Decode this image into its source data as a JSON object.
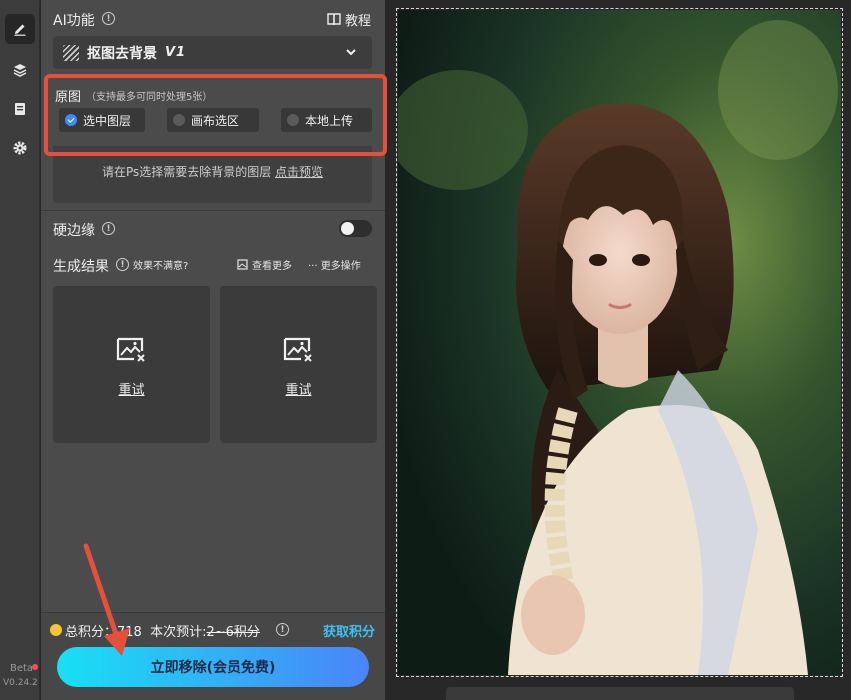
{
  "sidebar": {
    "beta_label": "Beta",
    "version": "V0.24.2"
  },
  "header": {
    "title": "AI功能",
    "tutorial_label": "教程"
  },
  "feature_select": {
    "label": "抠图去背景",
    "version": "V1"
  },
  "source": {
    "title": "原图",
    "subtitle": "（支持最多可同时处理5张）",
    "options": [
      {
        "label": "选中图层",
        "selected": true
      },
      {
        "label": "画布选区",
        "selected": false
      },
      {
        "label": "本地上传",
        "selected": false
      }
    ],
    "hint": "请在Ps选择需要去除背景的图层",
    "hint_link": "点击预览"
  },
  "hard_edge": {
    "label": "硬边缘",
    "enabled": false
  },
  "results": {
    "title": "生成结果",
    "unsatisfied": "效果不满意?",
    "view_more": "查看更多",
    "more_actions": "··· 更多操作",
    "cards": [
      {
        "label": "重试"
      },
      {
        "label": "重试"
      }
    ]
  },
  "footer": {
    "points_prefix": "总积分：",
    "points_value": "718",
    "estimate_prefix": "本次预计:",
    "estimate_value": "2~6积分",
    "get_points": "获取积分",
    "cta_label": "立即移除(会员免费)"
  },
  "colors": {
    "accent": "#3ec1f0",
    "annotation": "#e5503a",
    "cta_start": "#18e0f4",
    "cta_end": "#4a84f8"
  }
}
